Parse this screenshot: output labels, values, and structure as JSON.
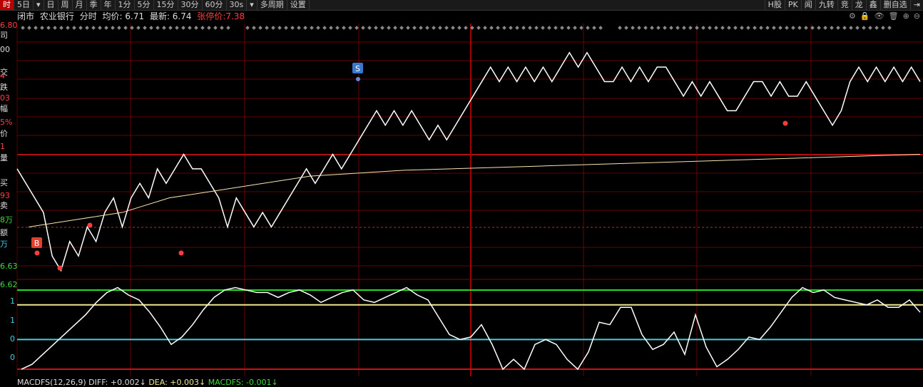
{
  "toolbar": {
    "left": [
      "时",
      "5日",
      "▾",
      "日",
      "周",
      "月",
      "季",
      "年",
      "1分",
      "5分",
      "15分",
      "30分",
      "60分",
      "30s",
      "▾",
      "多周期",
      "设置"
    ],
    "right": [
      "H股",
      "PK",
      "闻",
      "九转",
      "竞",
      "龙",
      "鑫",
      "删自选",
      "⇥"
    ]
  },
  "info": {
    "status": "闭市",
    "stock_name": "农业银行",
    "mode": "分时",
    "avg_price": "均价: 6.71",
    "latest": "最新: 6.74",
    "limit_up": "张停价:7.38"
  },
  "left_labels": [
    {
      "text": "6.80",
      "cls": "c-r"
    },
    {
      "text": "司",
      "cls": "c-w"
    },
    {
      "text": "00",
      "cls": "c-w"
    },
    {
      "text": "交",
      "cls": "c-w"
    },
    {
      "text": "4",
      "cls": "c-r"
    },
    {
      "text": "跌",
      "cls": "c-w"
    },
    {
      "text": "03",
      "cls": "c-r"
    },
    {
      "text": "幅",
      "cls": "c-w"
    },
    {
      "text": "5%",
      "cls": "c-r"
    },
    {
      "text": "价",
      "cls": "c-w"
    },
    {
      "text": "1",
      "cls": "c-r"
    },
    {
      "text": "量",
      "cls": "c-w"
    },
    {
      "text": "买",
      "cls": "c-w"
    },
    {
      "text": "93",
      "cls": "c-r"
    },
    {
      "text": "卖",
      "cls": "c-w"
    },
    {
      "text": "8万",
      "cls": "c-g"
    },
    {
      "text": "额",
      "cls": "c-w"
    },
    {
      "text": "万",
      "cls": "c-c"
    },
    {
      "text": "6.63",
      "cls": "c-g"
    },
    {
      "text": "6.62",
      "cls": "c-g"
    }
  ],
  "macd_axis": [
    "1",
    "1",
    "0",
    "0"
  ],
  "markers": {
    "buy": "B",
    "sell": "S"
  },
  "indicator": {
    "name": "MACDFS(12,26,9)",
    "diff": "DIFF: +0.002↓",
    "dea": "DEA: +0.003↓",
    "macdfs": "MACDFS: -0.001↓"
  },
  "colors": {
    "up": "#ff3b3b",
    "grid": "#6a0000",
    "price_line": "#ffffff",
    "avg_line": "#f5e6b0",
    "level_green": "#22dd22",
    "level_yellow": "#f0e68c",
    "level_cyan": "#40d0e0",
    "level_red": "#cc1111"
  },
  "chart_data": {
    "type": "line",
    "series": [
      {
        "name": "price",
        "values": [
          6.7,
          6.69,
          6.68,
          6.67,
          6.64,
          6.63,
          6.65,
          6.64,
          6.66,
          6.65,
          6.67,
          6.68,
          6.66,
          6.68,
          6.69,
          6.68,
          6.7,
          6.69,
          6.7,
          6.71,
          6.7,
          6.7,
          6.69,
          6.68,
          6.66,
          6.68,
          6.67,
          6.66,
          6.67,
          6.66,
          6.67,
          6.68,
          6.69,
          6.7,
          6.69,
          6.7,
          6.71,
          6.7,
          6.71,
          6.72,
          6.73,
          6.74,
          6.73,
          6.74,
          6.73,
          6.74,
          6.73,
          6.72,
          6.73,
          6.72,
          6.73,
          6.74,
          6.75,
          6.76,
          6.77,
          6.76,
          6.77,
          6.76,
          6.77,
          6.76,
          6.77,
          6.76,
          6.77,
          6.78,
          6.77,
          6.78,
          6.77,
          6.76,
          6.76,
          6.77,
          6.76,
          6.77,
          6.76,
          6.77,
          6.77,
          6.76,
          6.75,
          6.76,
          6.75,
          6.76,
          6.75,
          6.74,
          6.74,
          6.75,
          6.76,
          6.76,
          6.75,
          6.76,
          6.75,
          6.75,
          6.76,
          6.75,
          6.74,
          6.73,
          6.74,
          6.76,
          6.77,
          6.76,
          6.77,
          6.76,
          6.77,
          6.76,
          6.77,
          6.76
        ]
      },
      {
        "name": "average",
        "values": [
          6.66,
          6.665,
          6.67,
          6.68,
          6.685,
          6.69,
          6.695,
          6.697,
          6.699,
          6.7,
          6.701,
          6.702,
          6.703,
          6.704,
          6.705,
          6.706,
          6.707,
          6.708,
          6.709,
          6.71
        ]
      },
      {
        "name": "macd",
        "values": [
          -1.6,
          -1.4,
          -1.0,
          -0.6,
          -0.2,
          0.2,
          0.6,
          1.1,
          1.5,
          1.7,
          1.4,
          1.2,
          0.7,
          0.1,
          -0.6,
          -0.3,
          0.2,
          0.8,
          1.3,
          1.6,
          1.7,
          1.6,
          1.5,
          1.5,
          1.3,
          1.5,
          1.6,
          1.4,
          1.1,
          1.3,
          1.5,
          1.6,
          1.2,
          1.1,
          1.3,
          1.5,
          1.7,
          1.4,
          1.2,
          0.5,
          -0.2,
          -0.4,
          -0.3,
          0.2,
          -0.6,
          -1.6,
          -1.2,
          -1.6,
          -0.6,
          -0.4,
          -0.6,
          -1.2,
          -1.6,
          -0.9,
          0.3,
          0.2,
          0.9,
          0.9,
          -0.2,
          -0.8,
          -0.6,
          -0.1,
          -1.0,
          0.6,
          -0.7,
          -1.5,
          -1.2,
          -0.8,
          -0.3,
          -0.4,
          0.1,
          0.7,
          1.3,
          1.7,
          1.5,
          1.6,
          1.3,
          1.2,
          1.1,
          1.0,
          1.2,
          0.9,
          0.9,
          1.2,
          0.7
        ]
      }
    ],
    "reference_lines": {
      "pre_close": 6.7,
      "macd_levels": [
        1.6,
        1.0,
        -0.4,
        -1.6
      ]
    }
  }
}
